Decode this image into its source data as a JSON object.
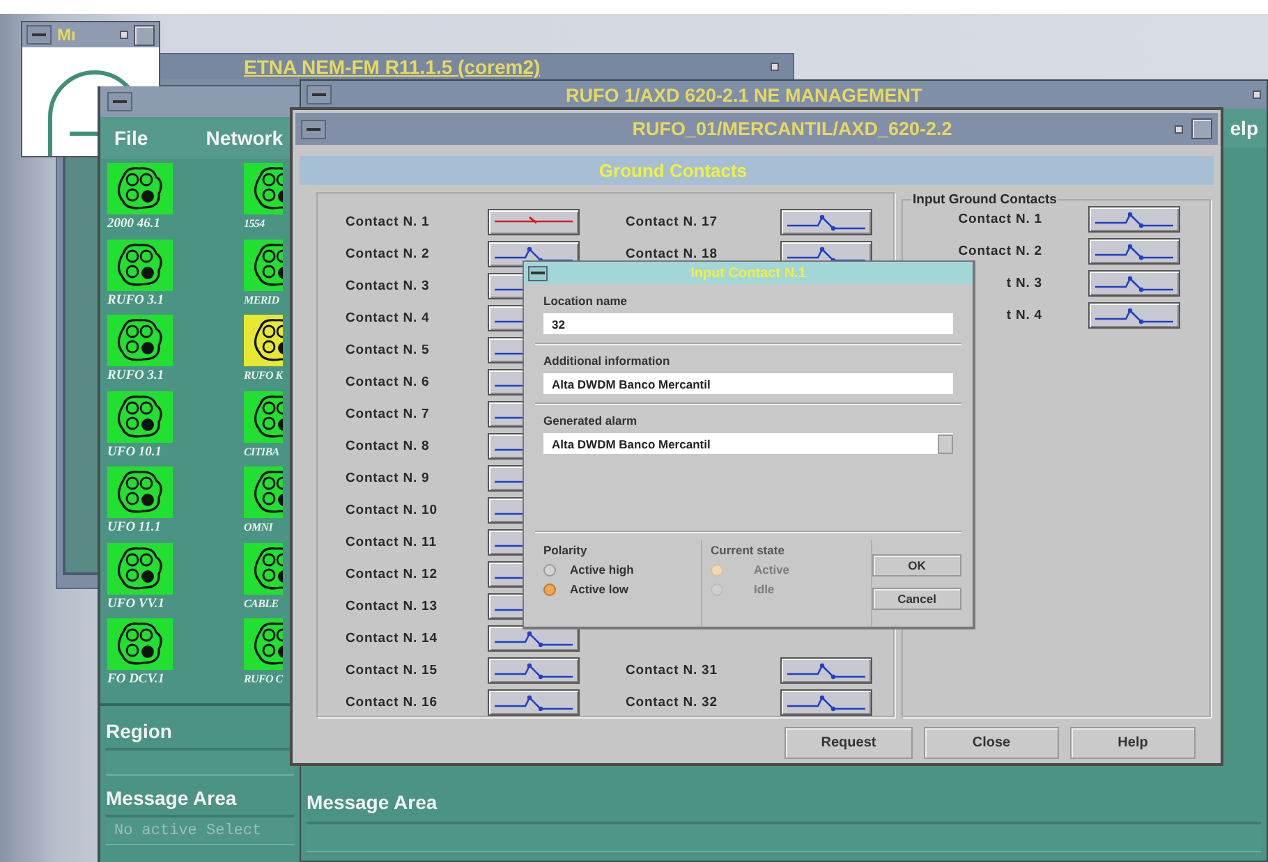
{
  "small_window": {
    "title": "Mı"
  },
  "etna_window": {
    "title": "ETNA NEM-FM R11.1.5 (corem2)"
  },
  "network_window": {
    "menu": [
      "File",
      "Network"
    ],
    "icons": [
      {
        "label": "2000 46.1",
        "color": "#22e030"
      },
      {
        "label": "1554",
        "color": "#22e030"
      },
      {
        "label": "RUFO 3.1",
        "color": "#22e030"
      },
      {
        "label": "MERID",
        "color": "#22e030"
      },
      {
        "label": "RUFO 3.1",
        "color": "#22e030"
      },
      {
        "label": "RUFO K",
        "color": "#e8e830"
      },
      {
        "label": "UFO 10.1",
        "color": "#22e030"
      },
      {
        "label": "CITIBA",
        "color": "#22e030"
      },
      {
        "label": "UFO 11.1",
        "color": "#22e030"
      },
      {
        "label": "OMNI",
        "color": "#22e030"
      },
      {
        "label": "UFO VV.1",
        "color": "#22e030"
      },
      {
        "label": "CABLE",
        "color": "#22e030"
      },
      {
        "label": "FO DCV.1",
        "color": "#22e030"
      },
      {
        "label": "RUFO C",
        "color": "#22e030"
      }
    ],
    "region_label": "Region",
    "message_label": "Message Area",
    "message_text": "No active Select"
  },
  "ne_window": {
    "title": "RUFO 1/AXD 620-2.1  NE MANAGEMENT",
    "menu": [
      "elp"
    ],
    "message_label": "Message Area"
  },
  "contacts_window": {
    "title": "RUFO_01/MERCANTIL/AXD_620-2.2",
    "header": "Ground Contacts",
    "columns": [
      {
        "contacts": [
          {
            "label": "Contact N. 1",
            "alarm": true
          },
          {
            "label": "Contact N. 2",
            "alarm": false
          },
          {
            "label": "Contact N. 3",
            "alarm": false
          },
          {
            "label": "Contact N. 4",
            "alarm": false
          },
          {
            "label": "Contact N. 5",
            "alarm": false
          },
          {
            "label": "Contact N. 6",
            "alarm": false
          },
          {
            "label": "Contact N. 7",
            "alarm": false
          },
          {
            "label": "Contact N. 8",
            "alarm": false
          },
          {
            "label": "Contact N. 9",
            "alarm": false
          },
          {
            "label": "Contact N. 10",
            "alarm": false
          },
          {
            "label": "Contact N. 11",
            "alarm": false
          },
          {
            "label": "Contact N. 12",
            "alarm": false
          },
          {
            "label": "Contact N. 13",
            "alarm": false
          },
          {
            "label": "Contact N. 14",
            "alarm": false
          },
          {
            "label": "Contact N. 15",
            "alarm": false
          },
          {
            "label": "Contact N. 16",
            "alarm": false
          }
        ]
      },
      {
        "contacts": [
          {
            "label": "Contact N. 17",
            "alarm": false
          },
          {
            "label": "Contact N. 18",
            "alarm": false
          },
          {
            "label": "Contact N. 31",
            "alarm": false
          },
          {
            "label": "Contact N. 32",
            "alarm": false
          }
        ]
      }
    ],
    "input_group": {
      "title": "Input Ground Contacts",
      "contacts": [
        {
          "label": "Contact N. 1",
          "alarm": false
        },
        {
          "label": "Contact N. 2",
          "alarm": false
        },
        {
          "label": "t N. 3",
          "alarm": false
        },
        {
          "label": "t N. 4",
          "alarm": false
        }
      ]
    },
    "buttons": [
      "Request",
      "Close",
      "Help"
    ]
  },
  "dialog": {
    "title": "Input Contact N.1",
    "fields": [
      {
        "label": "Location name",
        "value": "32",
        "kind": "text"
      },
      {
        "label": "Additional information",
        "value": "Alta DWDM Banco Mercantil",
        "kind": "text"
      },
      {
        "label": "Generated alarm",
        "value": "Alta DWDM Banco Mercantil",
        "kind": "dropdown"
      }
    ],
    "groups": [
      {
        "label": "Polarity",
        "disabled": false,
        "options": [
          {
            "label": "Active high",
            "selected": false
          },
          {
            "label": "Active low",
            "selected": true
          }
        ]
      },
      {
        "label": "Current state",
        "disabled": true,
        "options": [
          {
            "label": "Active",
            "selected": true
          },
          {
            "label": "Idle",
            "selected": false
          }
        ]
      }
    ],
    "buttons": [
      "OK",
      "Cancel"
    ]
  }
}
